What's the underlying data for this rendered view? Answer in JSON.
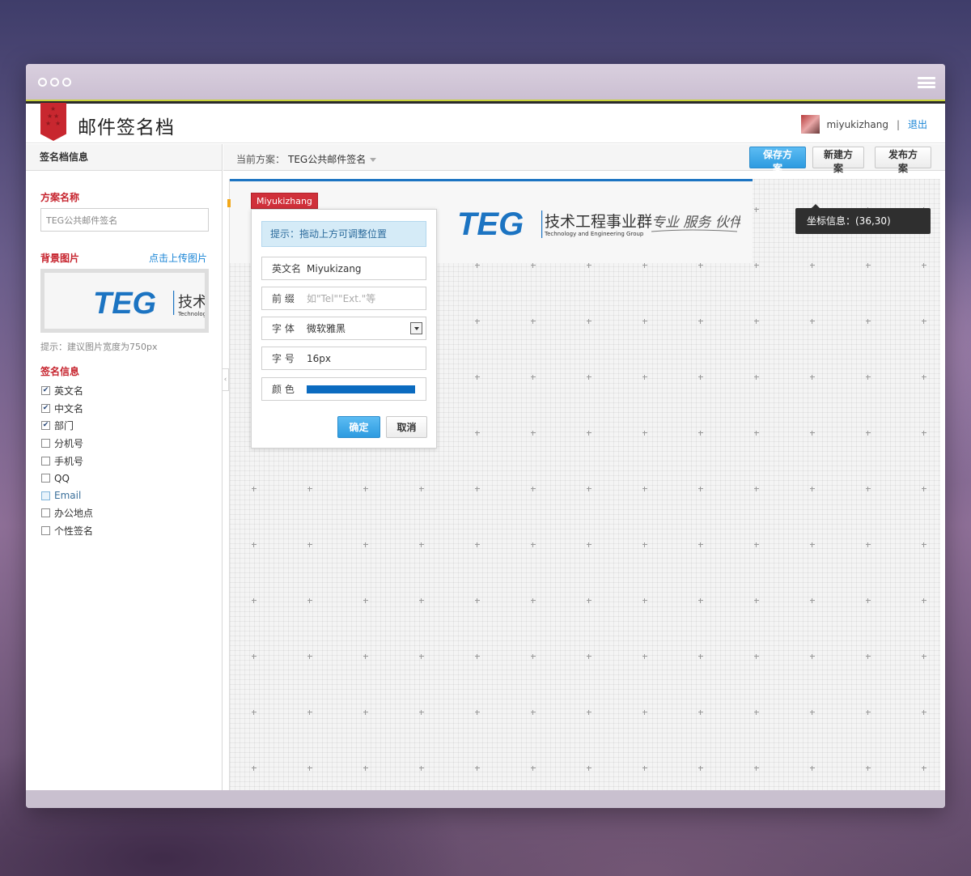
{
  "app": {
    "title": "邮件签名档",
    "user_name": "miyukizhang",
    "separator": "|",
    "logout_label": "退出"
  },
  "sidebar": {
    "header": "签名档信息",
    "plan_name_title": "方案名称",
    "plan_name_value": "TEG公共邮件签名",
    "bg_image_title": "背景图片",
    "upload_label": "点击上传图片",
    "bg_hint": "提示：建议图片宽度为750px",
    "sign_info_title": "签名信息",
    "fields": [
      {
        "label": "英文名",
        "checked": true
      },
      {
        "label": "中文名",
        "checked": true
      },
      {
        "label": "部门",
        "checked": true
      },
      {
        "label": "分机号",
        "checked": false
      },
      {
        "label": "手机号",
        "checked": false
      },
      {
        "label": "QQ",
        "checked": false
      },
      {
        "label": "Email",
        "checked": false,
        "highlight": true
      },
      {
        "label": "办公地点",
        "checked": false
      },
      {
        "label": "个性签名",
        "checked": false
      }
    ]
  },
  "toolbar": {
    "current_plan_label": "当前方案：",
    "current_plan_value": "TEG公共邮件签名",
    "save_label": "保存方案",
    "new_label": "新建方案",
    "publish_label": "发布方案"
  },
  "canvas": {
    "logo_text": "TEG",
    "logo_cn": "技术工程事业群",
    "logo_en": "Technology and Engineering Group",
    "slogan": "专业 服务 伙伴",
    "preview_cn": "技术",
    "preview_en": "Technolog",
    "element_tag": "Miyukizhang",
    "coord_tip": "坐标信息：(36,30)"
  },
  "editor": {
    "tip": "提示：拖动上方可调整位置",
    "english_name_label": "英文名",
    "english_name_value": "Miyukizang",
    "prefix_label": "前  缀",
    "prefix_placeholder": "如\"Tel\"\"Ext.\"等",
    "font_label": "字  体",
    "font_value": "微软雅黑",
    "size_label": "字  号",
    "size_value": "16px",
    "color_label": "颜  色",
    "color_value": "#0b6bc0",
    "ok_label": "确定",
    "cancel_label": "取消"
  },
  "colors": {
    "accent_blue": "#2d9be0",
    "ribbon_red": "#c8272f",
    "section_red": "#c6232d",
    "link_blue": "#1a85d6",
    "logo_blue": "#1c74c2"
  }
}
